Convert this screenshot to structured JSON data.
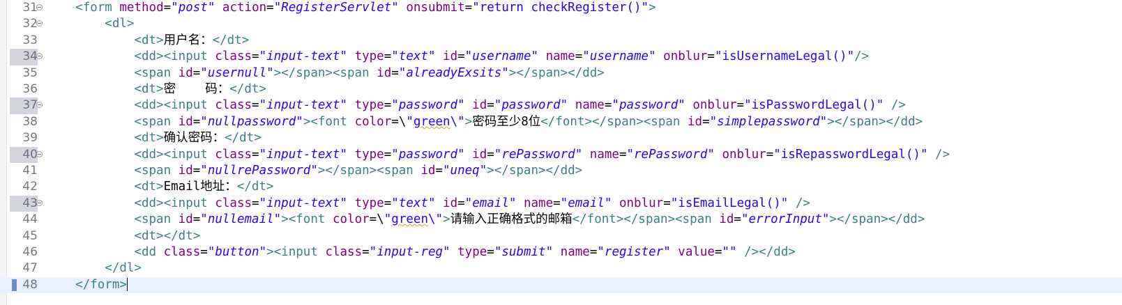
{
  "editor": {
    "lines": [
      {
        "n": "31",
        "fold": true,
        "marked": false,
        "html": "    <span class=\"tag\">&lt;form</span> <span class=\"attr\">method</span>=<span class=\"val\">\"post\"</span> <span class=\"attr\">action</span>=<span class=\"val\">\"RegisterServlet\"</span> <span class=\"attr\">onsubmit</span>=<span class=\"q\">\"return checkRegister()\"</span><span class=\"tag\">&gt;</span>"
      },
      {
        "n": "32",
        "fold": true,
        "marked": false,
        "html": "        <span class=\"tag\">&lt;dl&gt;</span>"
      },
      {
        "n": "33",
        "fold": false,
        "marked": false,
        "html": "            <span class=\"tag\">&lt;dt&gt;</span><span class=\"txt\">用户名：</span><span class=\"tag\">&lt;/dt&gt;</span>"
      },
      {
        "n": "34",
        "fold": true,
        "marked": true,
        "html": "            <span class=\"tag\">&lt;dd&gt;&lt;input</span> <span class=\"attr\">class</span>=<span class=\"val\">\"input-text\"</span> <span class=\"attr\">type</span>=<span class=\"val\">\"text\"</span> <span class=\"attr\">id</span>=<span class=\"val\">\"username\"</span> <span class=\"attr\">name</span>=<span class=\"val\">\"username\"</span> <span class=\"attr\">onblur</span>=<span class=\"q\">\"isUsernameLegal()\"</span><span class=\"tag\">/&gt;</span>"
      },
      {
        "n": "35",
        "fold": false,
        "marked": false,
        "html": "            <span class=\"tag\">&lt;span</span> <span class=\"attr\">id</span>=<span class=\"val\">\"usernull\"</span><span class=\"tag\">&gt;&lt;/span&gt;&lt;span</span> <span class=\"attr\">id</span>=<span class=\"val\">\"alreadyExsits\"</span><span class=\"tag\">&gt;&lt;/span&gt;&lt;/dd&gt;</span>"
      },
      {
        "n": "36",
        "fold": false,
        "marked": false,
        "html": "            <span class=\"tag\">&lt;dt&gt;</span><span class=\"txt\">密    码：</span><span class=\"tag\">&lt;/dt&gt;</span>"
      },
      {
        "n": "37",
        "fold": true,
        "marked": true,
        "html": "            <span class=\"tag\">&lt;dd&gt;&lt;input</span> <span class=\"attr\">class</span>=<span class=\"val\">\"input-text\"</span> <span class=\"attr\">type</span>=<span class=\"val\">\"password\"</span> <span class=\"attr\">id</span>=<span class=\"val\">\"password\"</span> <span class=\"attr\">name</span>=<span class=\"val\">\"password\"</span> <span class=\"attr\">onblur</span>=<span class=\"q\">\"isPasswordLegal()\"</span> <span class=\"tag\">/&gt;</span>"
      },
      {
        "n": "38",
        "fold": false,
        "marked": false,
        "html": "            <span class=\"tag\">&lt;span</span> <span class=\"attr\">id</span>=<span class=\"val\">\"nullpassword\"</span><span class=\"tag\">&gt;&lt;font</span> <span class=\"attr\">color</span>=<span class=\"esc\">\\</span><span class=\"q\">\"<span class=\"err\">green</span>\\\"</span><span class=\"tag\">&gt;</span><span class=\"txt\">密码至少8位</span><span class=\"tag\">&lt;/font&gt;&lt;/span&gt;&lt;span</span> <span class=\"attr\">id</span>=<span class=\"val\">\"simplepassword\"</span><span class=\"tag\">&gt;&lt;/span&gt;&lt;/dd&gt;</span>"
      },
      {
        "n": "39",
        "fold": false,
        "marked": false,
        "html": "            <span class=\"tag\">&lt;dt&gt;</span><span class=\"txt\">确认密码：</span><span class=\"tag\">&lt;/dt&gt;</span>"
      },
      {
        "n": "40",
        "fold": true,
        "marked": true,
        "html": "            <span class=\"tag\">&lt;dd&gt;&lt;input</span> <span class=\"attr\">class</span>=<span class=\"val\">\"input-text\"</span> <span class=\"attr\">type</span>=<span class=\"val\">\"password\"</span> <span class=\"attr\">id</span>=<span class=\"val\">\"rePassword\"</span> <span class=\"attr\">name</span>=<span class=\"val\">\"rePassword\"</span> <span class=\"attr\">onblur</span>=<span class=\"q\">\"isRepasswordLegal()\"</span> <span class=\"tag\">/&gt;</span>"
      },
      {
        "n": "41",
        "fold": false,
        "marked": false,
        "html": "            <span class=\"tag\">&lt;span</span> <span class=\"attr\">id</span>=<span class=\"val\">\"nullrePassword\"</span><span class=\"tag\">&gt;&lt;/span&gt;&lt;span</span> <span class=\"attr\">id</span>=<span class=\"val\">\"uneq\"</span><span class=\"tag\">&gt;&lt;/span&gt;&lt;/dd&gt;</span>"
      },
      {
        "n": "42",
        "fold": false,
        "marked": false,
        "html": "            <span class=\"tag\">&lt;dt&gt;</span><span class=\"txt\">Email地址：</span><span class=\"tag\">&lt;/dt&gt;</span>"
      },
      {
        "n": "43",
        "fold": true,
        "marked": true,
        "html": "            <span class=\"tag\">&lt;dd&gt;&lt;input</span> <span class=\"attr\">class</span>=<span class=\"val\">\"input-text\"</span> <span class=\"attr\">type</span>=<span class=\"val\">\"text\"</span> <span class=\"attr\">id</span>=<span class=\"val\">\"email\"</span> <span class=\"attr\">name</span>=<span class=\"val\">\"email\"</span> <span class=\"attr\">onblur</span>=<span class=\"q\">\"isEmailLegal()\"</span> <span class=\"tag\">/&gt;</span>"
      },
      {
        "n": "44",
        "fold": false,
        "marked": false,
        "html": "            <span class=\"tag\">&lt;span</span> <span class=\"attr\">id</span>=<span class=\"val\">\"nullemail\"</span><span class=\"tag\">&gt;&lt;font</span> <span class=\"attr\">color</span>=<span class=\"esc\">\\</span><span class=\"q\">\"<span class=\"err\">green</span>\\\"</span><span class=\"tag\">&gt;</span><span class=\"txt\">请输入正确格式的邮箱</span><span class=\"tag\">&lt;/font&gt;&lt;/span&gt;&lt;span</span> <span class=\"attr\">id</span>=<span class=\"val\">\"errorInput\"</span><span class=\"tag\">&gt;&lt;/span&gt;&lt;/dd&gt;</span>"
      },
      {
        "n": "45",
        "fold": false,
        "marked": false,
        "html": "            <span class=\"tag\">&lt;dt&gt;&lt;/dt&gt;</span>"
      },
      {
        "n": "46",
        "fold": false,
        "marked": false,
        "html": "            <span class=\"tag\">&lt;dd</span> <span class=\"attr\">class</span>=<span class=\"val\">\"button\"</span><span class=\"tag\">&gt;&lt;input</span> <span class=\"attr\">class</span>=<span class=\"val\">\"input-reg\"</span> <span class=\"attr\">type</span>=<span class=\"val\">\"submit\"</span> <span class=\"attr\">name</span>=<span class=\"val\">\"register\"</span> <span class=\"attr\">value</span>=<span class=\"val\">\"\"</span> <span class=\"tag\">/&gt;&lt;/dd&gt;</span>"
      },
      {
        "n": "47",
        "fold": false,
        "marked": false,
        "html": "        <span class=\"tag\">&lt;/dl&gt;</span>"
      },
      {
        "n": "48",
        "fold": false,
        "marked": false,
        "current": true,
        "html": "    <span class=\"tag\">&lt;/form&gt;</span><span class=\"cursor\"></span>"
      }
    ]
  },
  "colors": {
    "tag": "#3f7f7f",
    "attribute": "#7f007f",
    "value": "#2a00ff",
    "current_line": "#e8f2fe"
  }
}
